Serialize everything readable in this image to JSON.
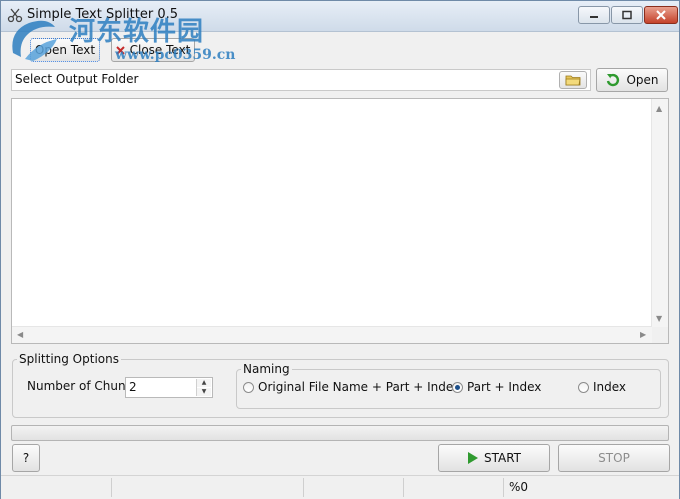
{
  "window": {
    "title": "Simple Text Splitter 0.5"
  },
  "watermark": {
    "site_name": "河东软件园",
    "url": "www.pc0359.cn"
  },
  "toolbar": {
    "open_text_label": "Open Text",
    "close_text_label": "Close Text"
  },
  "output": {
    "folder_value": "Select Output Folder",
    "open_label": "Open"
  },
  "editor": {
    "content": ""
  },
  "splitting": {
    "group_label": "Splitting Options",
    "chunks_label": "Number of Chunks:",
    "chunks_value": "2",
    "naming": {
      "group_label": "Naming",
      "options": [
        {
          "label": "Original File Name + Part + Index",
          "selected": false
        },
        {
          "label": "Part + Index",
          "selected": true
        },
        {
          "label": "Index",
          "selected": false
        }
      ]
    }
  },
  "progress": {
    "fraction": 0
  },
  "actions": {
    "help_label": "?",
    "start_label": "START",
    "stop_label": "STOP"
  },
  "status": {
    "percent_text": "%0"
  },
  "colors": {
    "accent_green": "#3fb33f",
    "close_red": "#c4422a",
    "watermark_blue": "#2e7fc1"
  }
}
